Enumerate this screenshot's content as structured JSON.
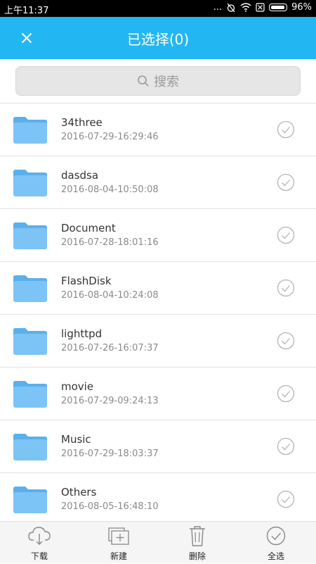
{
  "status_bar": {
    "time": "上午11:37",
    "dots": "...",
    "battery": "96%"
  },
  "app_bar": {
    "title": "已选择(0)"
  },
  "search": {
    "placeholder": "搜索"
  },
  "files": [
    {
      "name": "34three",
      "date": "2016-07-29-16:29:46"
    },
    {
      "name": "dasdsa",
      "date": "2016-08-04-10:50:08"
    },
    {
      "name": "Document",
      "date": "2016-07-28-18:01:16"
    },
    {
      "name": "FlashDisk",
      "date": "2016-08-04-10:24:08"
    },
    {
      "name": "lighttpd",
      "date": "2016-07-26-16:07:37"
    },
    {
      "name": "movie",
      "date": "2016-07-29-09:24:13"
    },
    {
      "name": "Music",
      "date": "2016-07-29-18:03:37"
    },
    {
      "name": "Others",
      "date": "2016-08-05-16:48:10"
    }
  ],
  "toolbar": {
    "download": "下载",
    "new": "新建",
    "delete": "删除",
    "select_all": "全选"
  },
  "colors": {
    "accent": "#22b7f2",
    "folder": "#7cc4f5"
  }
}
